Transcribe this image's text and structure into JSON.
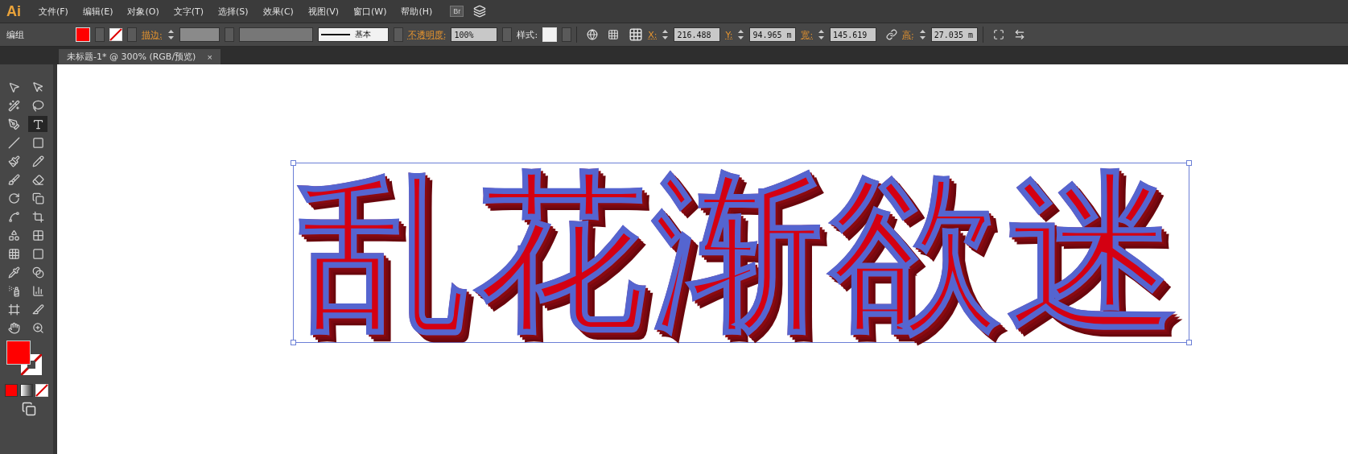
{
  "app": {
    "logo": "Ai",
    "bridge_button": "Br"
  },
  "menu": [
    "文件(F)",
    "编辑(E)",
    "对象(O)",
    "文字(T)",
    "选择(S)",
    "效果(C)",
    "视图(V)",
    "窗口(W)",
    "帮助(H)"
  ],
  "control_bar": {
    "selection": "编组",
    "fill": {
      "color": "#ff0000"
    },
    "stroke_link": "描边:",
    "stroke_profile": "基本",
    "opacity_link": "不透明度:",
    "opacity": "100%",
    "style_label": "样式:",
    "fields": [
      {
        "label": "X:",
        "value": "216.488"
      },
      {
        "label": "Y:",
        "value": "94.965 m"
      },
      {
        "label": "宽:",
        "value": "145.619"
      },
      {
        "label": "高:",
        "value": "27.035 m"
      }
    ]
  },
  "document_tab": {
    "title": "未标题-1* @ 300% (RGB/预览)",
    "close": "×"
  },
  "tools": [
    {
      "kind": "selection",
      "selected": false
    },
    {
      "kind": "direct",
      "selected": false
    },
    {
      "kind": "wand",
      "selected": false
    },
    {
      "kind": "lasso",
      "selected": false
    },
    {
      "kind": "pen",
      "selected": false
    },
    {
      "kind": "type",
      "selected": true
    },
    {
      "kind": "line",
      "selected": false
    },
    {
      "kind": "rect",
      "selected": false
    },
    {
      "kind": "brush",
      "selected": false
    },
    {
      "kind": "pencil",
      "selected": false
    },
    {
      "kind": "blob",
      "selected": false
    },
    {
      "kind": "eraser",
      "selected": false
    },
    {
      "kind": "rotate",
      "selected": false
    },
    {
      "kind": "scale",
      "selected": false
    },
    {
      "kind": "warp",
      "selected": false
    },
    {
      "kind": "transform",
      "selected": false
    },
    {
      "kind": "shapebuilder",
      "selected": false
    },
    {
      "kind": "perspective",
      "selected": false
    },
    {
      "kind": "mesh",
      "selected": false
    },
    {
      "kind": "gradient",
      "selected": false
    },
    {
      "kind": "eyedropper",
      "selected": false
    },
    {
      "kind": "blend",
      "selected": false
    },
    {
      "kind": "spray",
      "selected": false
    },
    {
      "kind": "graph",
      "selected": false
    },
    {
      "kind": "artboard",
      "selected": false
    },
    {
      "kind": "slice",
      "selected": false
    },
    {
      "kind": "hand",
      "selected": false
    },
    {
      "kind": "zoom",
      "selected": false
    }
  ],
  "swatches": {
    "fill": {
      "color": "#ff0000"
    }
  },
  "artwork": {
    "text": "乱花渐欲迷",
    "color": "#d40012"
  }
}
